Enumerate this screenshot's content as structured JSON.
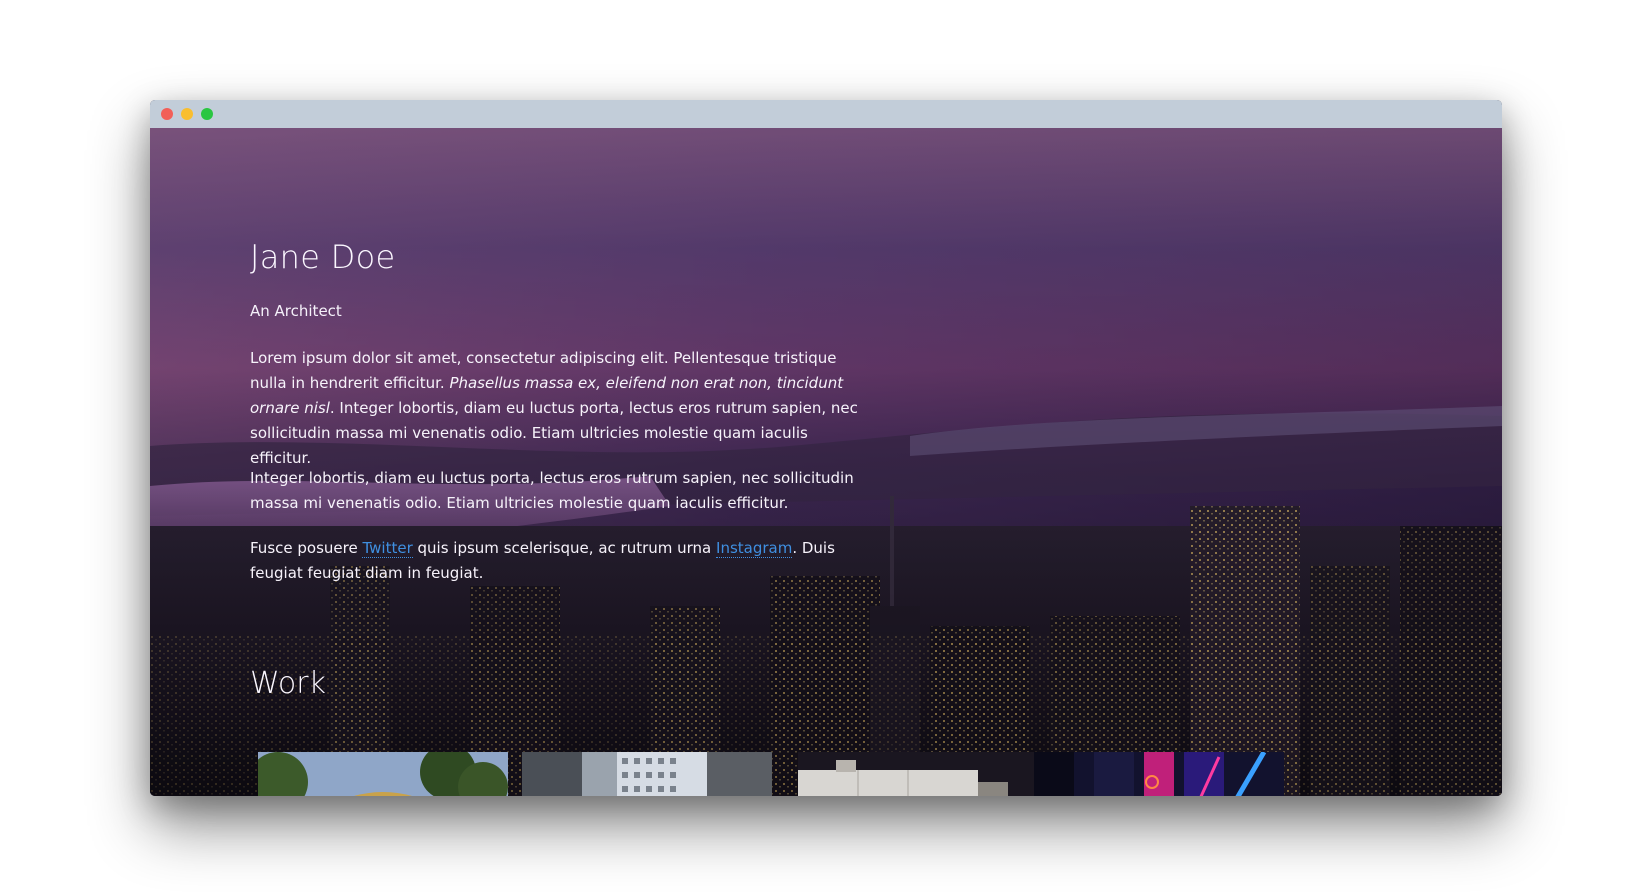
{
  "window": {
    "buttons": {
      "close_color": "#f25f58",
      "minimize_color": "#f9be2f",
      "maximize_color": "#2ac641"
    }
  },
  "profile": {
    "name": "Jane Doe",
    "subtitle": "An Architect",
    "paragraph_1_part_1": "Lorem ipsum dolor sit amet, consectetur adipiscing elit. Pellentesque tristique nulla in hendrerit efficitur. ",
    "paragraph_1_emphasis": "Phasellus massa ex, eleifend non erat non, tincidunt ornare nisl",
    "paragraph_1_part_2": ". Integer lobortis, diam eu luctus porta, lectus eros rutrum sapien, nec sollicitudin massa mi venenatis odio. Etiam ultricies molestie quam iaculis efficitur.",
    "paragraph_2": "Integer lobortis, diam eu luctus porta, lectus eros rutrum sapien, nec sollicitudin massa mi venenatis odio. Etiam ultricies molestie quam iaculis efficitur.",
    "paragraph_3_part_1": "Fusce posuere ",
    "twitter_link": "Twitter",
    "paragraph_3_part_2": " quis ipsum scelerisque, ac rutrum urna ",
    "instagram_link": "Instagram",
    "paragraph_3_part_3": ". Duis feugiat feugiat diam in feugiat."
  },
  "work": {
    "title": "Work",
    "thumbnails": [
      {
        "subject": "dome-building-with-trees"
      },
      {
        "subject": "city-towers"
      },
      {
        "subject": "concrete-building"
      },
      {
        "subject": "neon-signs"
      }
    ]
  },
  "colors": {
    "link": "#3f8fe0",
    "titlebar": "#c2cdd9",
    "text": "#ffffff"
  }
}
